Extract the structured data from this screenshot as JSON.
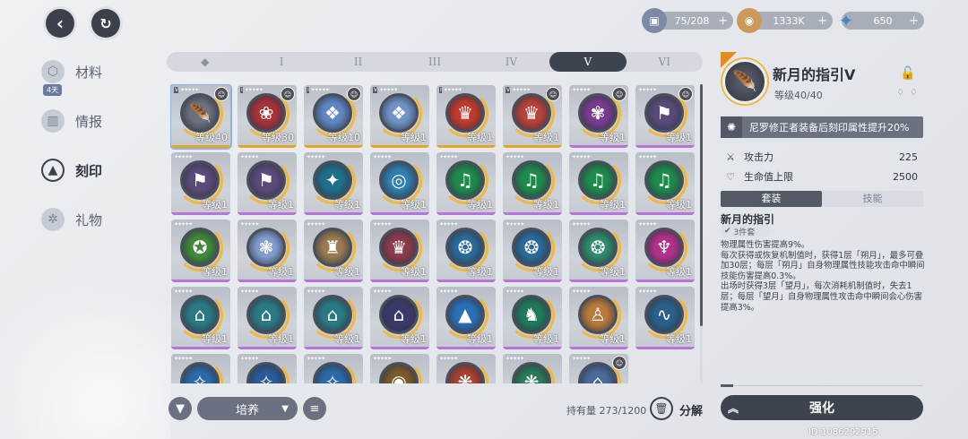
{
  "resources": [
    {
      "name": "stamina",
      "icon": "stamina-icon",
      "value": "75/208"
    },
    {
      "name": "credits",
      "icon": "coin-icon",
      "value": "1333K"
    },
    {
      "name": "crystal",
      "icon": "crystal-icon",
      "value": "650"
    }
  ],
  "sidebar": {
    "days_badge": "4天",
    "items": [
      {
        "label": "材料",
        "icon": "cube-icon",
        "active": false
      },
      {
        "label": "情报",
        "icon": "book-icon",
        "active": false
      },
      {
        "label": "刻印",
        "icon": "triangle-sigil-icon",
        "active": true
      },
      {
        "label": "礼物",
        "icon": "gift-icon",
        "active": false
      }
    ]
  },
  "tabs": [
    "◆",
    "I",
    "II",
    "III",
    "IV",
    "V",
    "VI"
  ],
  "selected_tab": 5,
  "cards": [
    {
      "level": "等级40",
      "rarity": "gold",
      "glyph": "🪶",
      "tier": "V",
      "avatar": true,
      "selected": true,
      "color": "#6b7180"
    },
    {
      "level": "等级30",
      "rarity": "gold",
      "glyph": "❀",
      "tier": "I",
      "avatar": true,
      "selected": false,
      "color": "#a8323a"
    },
    {
      "level": "等级10",
      "rarity": "gold",
      "glyph": "❖",
      "tier": "I",
      "avatar": true,
      "selected": false,
      "color": "#5f86c2"
    },
    {
      "level": "等级1",
      "rarity": "gold",
      "glyph": "❖",
      "tier": "V",
      "avatar": false,
      "selected": false,
      "color": "#6e93c8"
    },
    {
      "level": "等级1",
      "rarity": "gold",
      "glyph": "♛",
      "tier": "I",
      "avatar": false,
      "selected": false,
      "color": "#c0392b"
    },
    {
      "level": "等级1",
      "rarity": "gold",
      "glyph": "♛",
      "tier": "V",
      "avatar": true,
      "selected": false,
      "color": "#b8413a"
    },
    {
      "level": "等级1",
      "rarity": "purple",
      "glyph": "✾",
      "tier": "",
      "avatar": true,
      "selected": false,
      "color": "#7a3b8f"
    },
    {
      "level": "等级1",
      "rarity": "purple",
      "glyph": "⚑",
      "tier": "",
      "avatar": true,
      "selected": false,
      "color": "#5a4a7a"
    },
    {
      "level": "等级1",
      "rarity": "purple",
      "glyph": "⚑",
      "tier": "",
      "avatar": false,
      "selected": false,
      "color": "#5a4a7a"
    },
    {
      "level": "等级1",
      "rarity": "purple",
      "glyph": "⚑",
      "tier": "",
      "avatar": false,
      "selected": false,
      "color": "#5a4a7a"
    },
    {
      "level": "等级1",
      "rarity": "purple",
      "glyph": "✦",
      "tier": "",
      "avatar": false,
      "selected": false,
      "color": "#1f6f8b"
    },
    {
      "level": "等级1",
      "rarity": "purple",
      "glyph": "◎",
      "tier": "",
      "avatar": false,
      "selected": false,
      "color": "#2f7fb0"
    },
    {
      "level": "等级1",
      "rarity": "purple",
      "glyph": "♫",
      "tier": "",
      "avatar": false,
      "selected": false,
      "color": "#1e8a4c"
    },
    {
      "level": "等级1",
      "rarity": "purple",
      "glyph": "♫",
      "tier": "",
      "avatar": false,
      "selected": false,
      "color": "#1e8a4c"
    },
    {
      "level": "等级1",
      "rarity": "purple",
      "glyph": "♫",
      "tier": "",
      "avatar": false,
      "selected": false,
      "color": "#1e8a4c"
    },
    {
      "level": "等级1",
      "rarity": "purple",
      "glyph": "♫",
      "tier": "",
      "avatar": false,
      "selected": false,
      "color": "#1e8a4c"
    },
    {
      "level": "等级1",
      "rarity": "purple",
      "glyph": "✪",
      "tier": "",
      "avatar": false,
      "selected": false,
      "color": "#3f8a3a"
    },
    {
      "level": "等级1",
      "rarity": "purple",
      "glyph": "❃",
      "tier": "",
      "avatar": false,
      "selected": false,
      "color": "#7f9ccc"
    },
    {
      "level": "等级1",
      "rarity": "purple",
      "glyph": "♜",
      "tier": "",
      "avatar": false,
      "selected": false,
      "color": "#9a7a52"
    },
    {
      "level": "等级1",
      "rarity": "purple",
      "glyph": "♛",
      "tier": "",
      "avatar": false,
      "selected": false,
      "color": "#8a3a4a"
    },
    {
      "level": "等级1",
      "rarity": "purple",
      "glyph": "❂",
      "tier": "",
      "avatar": false,
      "selected": false,
      "color": "#2a6a9a"
    },
    {
      "level": "等级1",
      "rarity": "purple",
      "glyph": "❂",
      "tier": "",
      "avatar": false,
      "selected": false,
      "color": "#2a6a9a"
    },
    {
      "level": "等级1",
      "rarity": "purple",
      "glyph": "❂",
      "tier": "",
      "avatar": false,
      "selected": false,
      "color": "#2e8a6a"
    },
    {
      "level": "等级1",
      "rarity": "purple",
      "glyph": "♆",
      "tier": "",
      "avatar": false,
      "selected": false,
      "color": "#b0308a"
    },
    {
      "level": "等级1",
      "rarity": "purple",
      "glyph": "⌂",
      "tier": "",
      "avatar": false,
      "selected": false,
      "color": "#2a7a86"
    },
    {
      "level": "等级1",
      "rarity": "purple",
      "glyph": "⌂",
      "tier": "",
      "avatar": false,
      "selected": false,
      "color": "#2a7a86"
    },
    {
      "level": "等级1",
      "rarity": "purple",
      "glyph": "⌂",
      "tier": "",
      "avatar": false,
      "selected": false,
      "color": "#2a7a86"
    },
    {
      "level": "等级1",
      "rarity": "purple",
      "glyph": "⌂",
      "tier": "",
      "avatar": false,
      "selected": false,
      "color": "#3a3a6a"
    },
    {
      "level": "等级1",
      "rarity": "purple",
      "glyph": "▲",
      "tier": "",
      "avatar": false,
      "selected": false,
      "color": "#2a70b8"
    },
    {
      "level": "等级1",
      "rarity": "purple",
      "glyph": "♞",
      "tier": "",
      "avatar": false,
      "selected": false,
      "color": "#1f7a5c"
    },
    {
      "level": "等级1",
      "rarity": "purple",
      "glyph": "♙",
      "tier": "",
      "avatar": false,
      "selected": false,
      "color": "#b87a3a"
    },
    {
      "level": "等级1",
      "rarity": "purple",
      "glyph": "∿",
      "tier": "",
      "avatar": false,
      "selected": false,
      "color": "#2a5f8a"
    },
    {
      "level": "",
      "rarity": "none",
      "glyph": "✧",
      "tier": "",
      "avatar": false,
      "selected": false,
      "color": "#2a6aa8"
    },
    {
      "level": "",
      "rarity": "none",
      "glyph": "✧",
      "tier": "",
      "avatar": false,
      "selected": false,
      "color": "#2a5a98"
    },
    {
      "level": "",
      "rarity": "none",
      "glyph": "✧",
      "tier": "",
      "avatar": false,
      "selected": false,
      "color": "#2a6aa8"
    },
    {
      "level": "",
      "rarity": "none",
      "glyph": "◉",
      "tier": "",
      "avatar": false,
      "selected": false,
      "color": "#7a5a2a"
    },
    {
      "level": "",
      "rarity": "none",
      "glyph": "❋",
      "tier": "",
      "avatar": false,
      "selected": false,
      "color": "#a84030"
    },
    {
      "level": "",
      "rarity": "none",
      "glyph": "❋",
      "tier": "",
      "avatar": false,
      "selected": false,
      "color": "#2a7a5a"
    },
    {
      "level": "",
      "rarity": "none",
      "glyph": "⌂",
      "tier": "",
      "avatar": true,
      "selected": false,
      "color": "#4a6a9a"
    }
  ],
  "bottom": {
    "filter_dropdown": "培养",
    "owned_text": "持有量 273/1200",
    "decompose_label": "分解"
  },
  "detail": {
    "title": "新月的指引V",
    "level_text": "等级40/40",
    "buff": "尼罗修正者装备后刻印属性提升20%",
    "stats": [
      {
        "label": "攻击力",
        "value": "225",
        "icon": "sword-icon"
      },
      {
        "label": "生命值上限",
        "value": "2500",
        "icon": "heart-icon"
      }
    ],
    "tabs": [
      "套装",
      "技能"
    ],
    "set_name": "新月的指引",
    "set_badge": "3件套",
    "description": "物理属性伤害提高9%。\n每次获得或恢复机制值时，获得1层「朔月」，最多可叠加30层；每层「朔月」自身物理属性技能攻击命中瞬间技能伤害提高0.3%。\n出场时获得3层「望月」，每次消耗机制值时，失去1层；每层「望月」自身物理属性攻击命中瞬间会心伤害提高3%。",
    "upgrade_label": "强化"
  },
  "uid": "ID:1086292915"
}
